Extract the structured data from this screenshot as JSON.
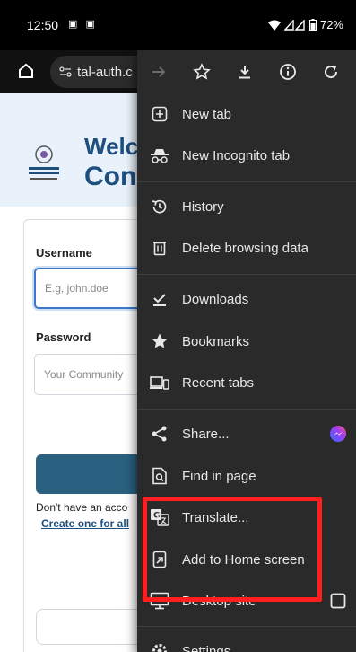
{
  "status_bar": {
    "time": "12:50",
    "left_icons": "▣ ▣",
    "battery": "72%"
  },
  "toolbar": {
    "url": "tal-auth.c"
  },
  "page": {
    "title_line1": "Welc",
    "title_line2": "Con",
    "username_label": "Username",
    "username_placeholder": "E.g, john.doe",
    "password_label": "Password",
    "password_placeholder": "Your Community",
    "no_account": "Don't have an acco",
    "create_link": "Create one for all",
    "google_g": "G"
  },
  "menu": {
    "items": [
      {
        "label": "New tab",
        "icon": "plus-square-icon"
      },
      {
        "label": "New Incognito tab",
        "icon": "incognito-icon"
      },
      {
        "label": "History",
        "icon": "history-icon"
      },
      {
        "label": "Delete browsing data",
        "icon": "trash-icon"
      },
      {
        "label": "Downloads",
        "icon": "download-done-icon"
      },
      {
        "label": "Bookmarks",
        "icon": "star-filled-icon"
      },
      {
        "label": "Recent tabs",
        "icon": "devices-icon"
      },
      {
        "label": "Share...",
        "icon": "share-icon"
      },
      {
        "label": "Find in page",
        "icon": "find-in-page-icon"
      },
      {
        "label": "Translate...",
        "icon": "translate-icon"
      },
      {
        "label": "Add to Home screen",
        "icon": "add-to-home-icon"
      },
      {
        "label": "Desktop site",
        "icon": "desktop-icon"
      },
      {
        "label": "Settings",
        "icon": "gear-icon"
      }
    ]
  },
  "colors": {
    "menu_bg": "#2a2a2a",
    "highlight": "#ff1f1f",
    "brand_blue": "#1e4f7f"
  }
}
